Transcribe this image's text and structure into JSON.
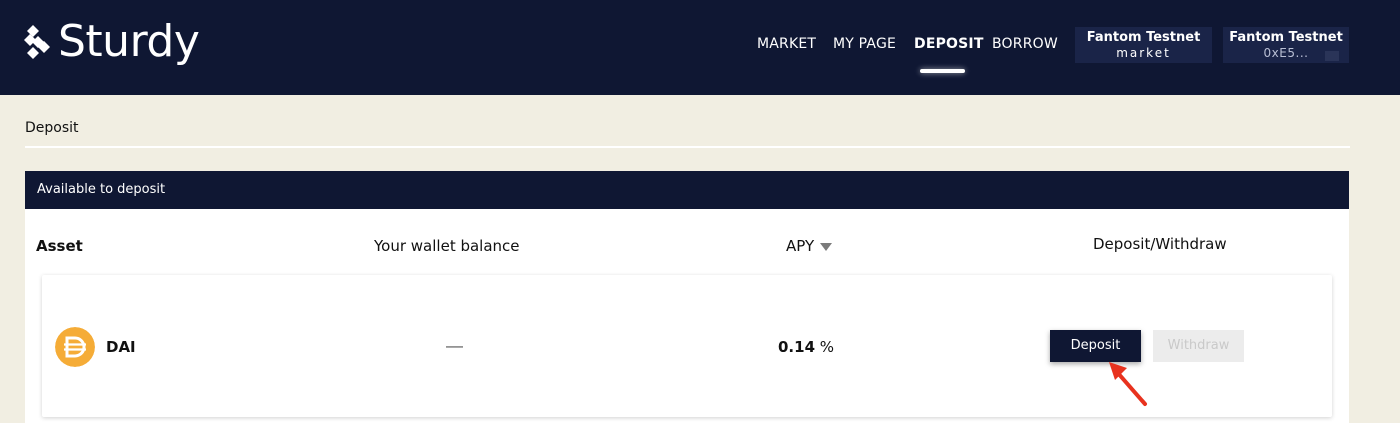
{
  "brand": {
    "name": "Sturdy"
  },
  "nav": {
    "items": [
      {
        "label": "MARKET",
        "active": false
      },
      {
        "label": "MY PAGE",
        "active": false
      },
      {
        "label": "DEPOSIT",
        "active": true
      },
      {
        "label": "BORROW",
        "active": false
      }
    ]
  },
  "network_button": {
    "line1": "Fantom Testnet",
    "line2": "market"
  },
  "wallet_button": {
    "line1": "Fantom Testnet",
    "line2": "0xE5..."
  },
  "page": {
    "title": "Deposit"
  },
  "panel": {
    "header": "Available to deposit",
    "columns": {
      "asset": "Asset",
      "balance": "Your wallet balance",
      "apy": "APY",
      "action": "Deposit/Withdraw"
    },
    "rows": [
      {
        "asset": "DAI",
        "balance": "—",
        "apy_value": "0.14",
        "apy_unit": "%",
        "deposit_label": "Deposit",
        "withdraw_label": "Withdraw"
      }
    ]
  },
  "colors": {
    "navy": "#0f1733",
    "background": "#f1eee2",
    "dai": "#f5ac37",
    "annotation": "#e8321e"
  }
}
